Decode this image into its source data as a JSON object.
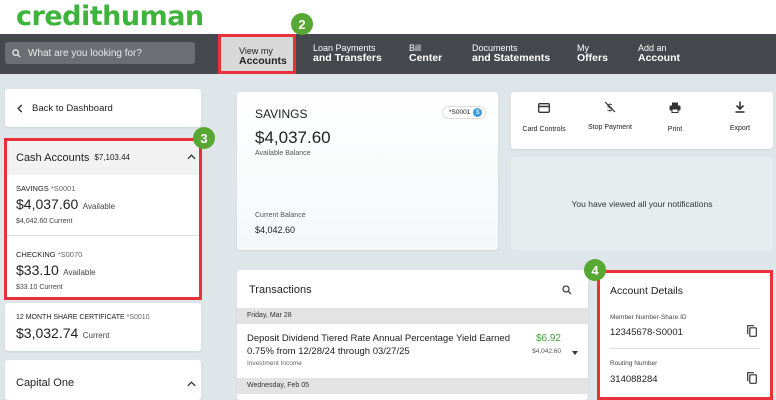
{
  "logo": {
    "text": "credithuman"
  },
  "search": {
    "placeholder": "What are you looking for?"
  },
  "nav": {
    "accounts": {
      "top": "View my",
      "bottom": "Accounts"
    },
    "loans": {
      "top": "Loan Payments",
      "bottom": "and Transfers"
    },
    "bill": {
      "top": "Bill",
      "bottom": "Center"
    },
    "docs": {
      "top": "Documents",
      "bottom": "and Statements"
    },
    "offers": {
      "top": "My",
      "bottom": "Offers"
    },
    "add": {
      "top": "Add an",
      "bottom": "Account"
    }
  },
  "steps": {
    "s2": "2",
    "s3": "3",
    "s4": "4"
  },
  "sidebar": {
    "back": "Back to Dashboard",
    "cash_title": "Cash Accounts",
    "cash_total": "$7,103.44",
    "accounts": [
      {
        "name": "SAVINGS",
        "id": "*S0001",
        "amount": "$4,037.60",
        "amount_label": "Available",
        "current": "$4,042.60 Current"
      },
      {
        "name": "CHECKING",
        "id": "*S0070",
        "amount": "$33.10",
        "amount_label": "Available",
        "current": "$33.10 Current"
      },
      {
        "name": "12 MONTH SHARE CERTIFICATE",
        "id": "*S0010",
        "amount": "$3,032.74",
        "amount_label": "Current"
      }
    ],
    "capital_one": "Capital One"
  },
  "savings_card": {
    "title": "SAVINGS",
    "badge": "*S0001",
    "balance": "$4,037.60",
    "balance_label": "Available Balance",
    "current_label": "Current Balance",
    "current_value": "$4,042.60"
  },
  "actions": [
    {
      "label": "Card Controls",
      "icon": "card-icon"
    },
    {
      "label": "Stop Payment",
      "icon": "stop-payment-icon"
    },
    {
      "label": "Print",
      "icon": "print-icon"
    },
    {
      "label": "Export",
      "icon": "export-icon"
    }
  ],
  "notifications": {
    "text": "You have viewed all your notifications"
  },
  "transactions": {
    "title": "Transactions",
    "date1": "Friday, Mar 28",
    "item1": {
      "desc": "Deposit Dividend Tiered Rate Annual Percentage Yield Earned 0.75% from 12/28/24 through 03/27/25",
      "type": "Investment Income",
      "amount": "$6.92",
      "balance": "$4,042.60"
    },
    "date2": "Wednesday, Feb 05"
  },
  "account_details": {
    "title": "Account Details",
    "member_label": "Member Number-Share ID",
    "member_value": "12345678-S0001",
    "routing_label": "Routing Number",
    "routing_value": "314088284"
  },
  "colors": {
    "brand_green": "#3fb43c",
    "highlight_red": "#e8313a",
    "step_green": "#56a832",
    "nav_bg": "#45484d"
  }
}
